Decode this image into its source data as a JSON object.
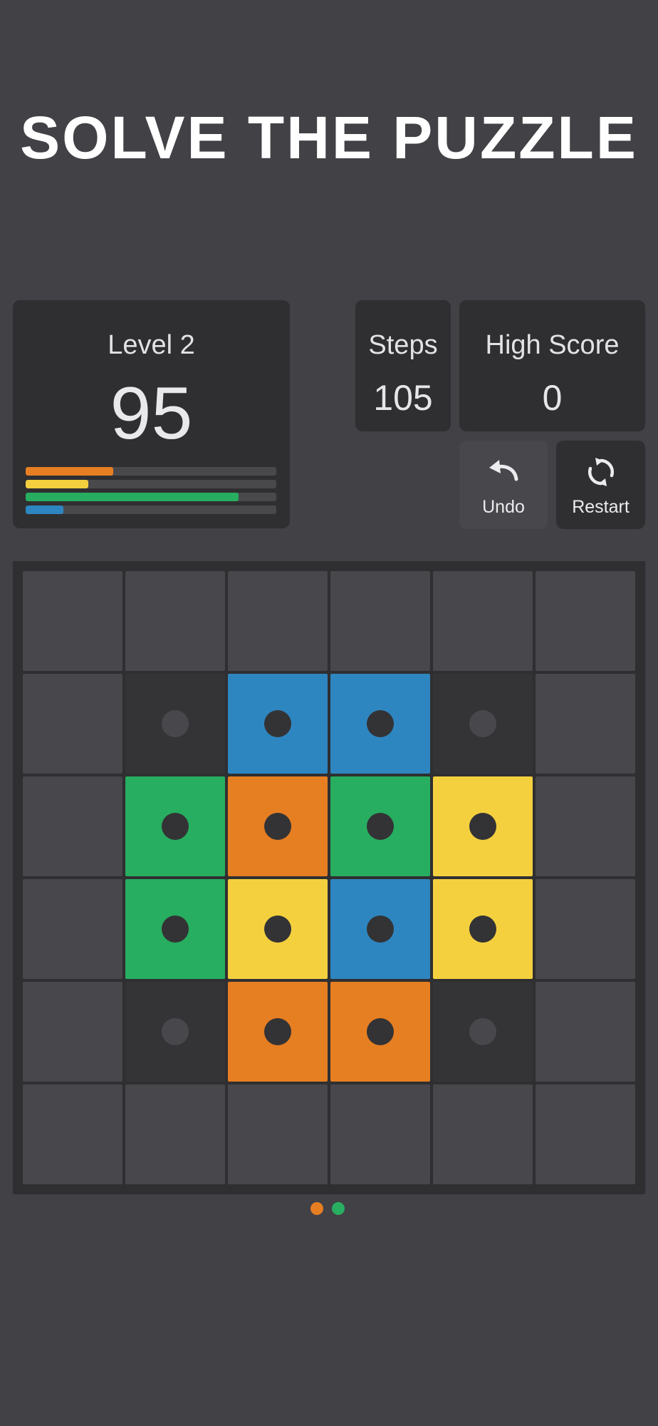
{
  "headline": "SOLVE THE PUZZLE",
  "level": {
    "label": "Level 2",
    "score": "95",
    "progress": [
      {
        "color": "#e67e22",
        "fraction": 0.35
      },
      {
        "color": "#f4d03f",
        "fraction": 0.25
      },
      {
        "color": "#27ae60",
        "fraction": 0.85
      },
      {
        "color": "#2e86c1",
        "fraction": 0.15
      }
    ]
  },
  "steps": {
    "label": "Steps",
    "value": "105"
  },
  "high_score": {
    "label": "High Score",
    "value": "0"
  },
  "buttons": {
    "undo": {
      "label": "Undo",
      "icon": "undo-arrow-icon"
    },
    "restart": {
      "label": "Restart",
      "icon": "restart-circular-icon"
    }
  },
  "colors": {
    "orange": "#e67e22",
    "yellow": "#f4d03f",
    "green": "#27ae60",
    "blue": "#2e86c1",
    "empty": "#47474c",
    "hole": "#343436",
    "dot_on_tile": "#333335",
    "dot_on_hole": "#48484c"
  },
  "board": {
    "rows": [
      [
        "empty",
        "empty",
        "empty",
        "empty",
        "empty",
        "empty"
      ],
      [
        "empty",
        "hole",
        "blue",
        "blue",
        "hole",
        "empty"
      ],
      [
        "empty",
        "green",
        "orange",
        "green",
        "yellow",
        "empty"
      ],
      [
        "empty",
        "green",
        "yellow",
        "blue",
        "yellow",
        "empty"
      ],
      [
        "empty",
        "hole",
        "orange",
        "orange",
        "hole",
        "empty"
      ],
      [
        "empty",
        "empty",
        "empty",
        "empty",
        "empty",
        "empty"
      ]
    ]
  },
  "pager": {
    "dots": [
      {
        "color": "#e67e22"
      },
      {
        "color": "#27ae60"
      }
    ]
  }
}
